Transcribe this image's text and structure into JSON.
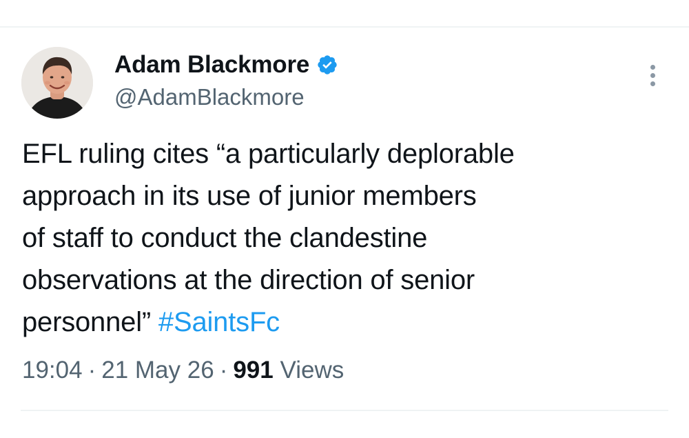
{
  "author": {
    "display_name": "Adam Blackmore",
    "handle": "@AdamBlackmore",
    "verified": true,
    "verified_badge_color": "#1d9bf0",
    "avatar": "profile-photo"
  },
  "tweet": {
    "text": "EFL ruling cites “a particularly deplorable\napproach in its use of junior members\nof staff to conduct the clandestine\nobservations at the direction of senior\npersonnel” ",
    "hashtag": "#SaintsFc",
    "time": "19:04",
    "separator": "·",
    "date": "21 May 26",
    "views_count": "991",
    "views_label": "Views"
  },
  "icons": {
    "more": "more-vertical-icon",
    "verified": "verified-badge-icon"
  },
  "colors": {
    "text": "#0f1419",
    "secondary_text": "#536471",
    "link": "#1d9bf0",
    "divider": "#eff3f4"
  }
}
